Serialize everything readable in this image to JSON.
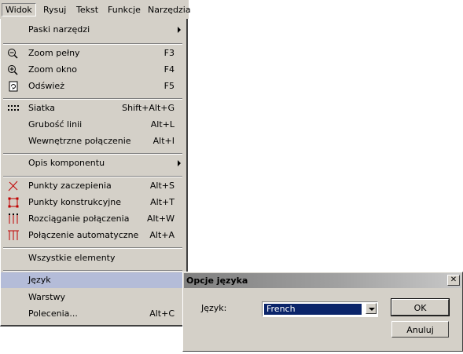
{
  "menubar": {
    "items": [
      {
        "label": "Widok"
      },
      {
        "label": "Rysuj"
      },
      {
        "label": "Tekst"
      },
      {
        "label": "Funkcje"
      },
      {
        "label": "Narzędzia"
      }
    ]
  },
  "menu": {
    "items": [
      {
        "label": "Paski narzędzi",
        "shortcut": "",
        "submenu": true
      },
      {
        "label": "Zoom pełny",
        "shortcut": "F3",
        "icon": "zoom-out-icon"
      },
      {
        "label": "Zoom okno",
        "shortcut": "F4",
        "icon": "zoom-in-icon"
      },
      {
        "label": "Odśwież",
        "shortcut": "F5",
        "icon": "refresh-icon"
      },
      {
        "label": "Siatka",
        "shortcut": "Shift+Alt+G",
        "icon": "grid-dots-icon"
      },
      {
        "label": "Grubość linii",
        "shortcut": "Alt+L"
      },
      {
        "label": "Wewnętrzne połączenie",
        "shortcut": "Alt+I"
      },
      {
        "label": "Opis komponentu",
        "shortcut": "",
        "submenu": true
      },
      {
        "label": "Punkty zaczepienia",
        "shortcut": "Alt+S",
        "icon": "cross-points-icon"
      },
      {
        "label": "Punkty konstrukcyjne",
        "shortcut": "Alt+T",
        "icon": "construction-points-icon"
      },
      {
        "label": "Rozciąganie połączenia",
        "shortcut": "Alt+W",
        "icon": "stretch-connection-icon"
      },
      {
        "label": "Połączenie automatyczne",
        "shortcut": "Alt+A",
        "icon": "auto-connection-icon"
      },
      {
        "label": "Wszystkie elementy",
        "shortcut": ""
      },
      {
        "label": "Język",
        "shortcut": "",
        "highlighted": true
      },
      {
        "label": "Warstwy",
        "shortcut": ""
      },
      {
        "label": "Polecenia...",
        "shortcut": "Alt+C"
      }
    ]
  },
  "dialog": {
    "title": "Opcje języka",
    "close_label": "✕",
    "language_label": "Język:",
    "language_value": "French",
    "ok_label": "OK",
    "cancel_label": "Anuluj"
  },
  "colors": {
    "menu_bg": "#d4d0c8",
    "highlight": "#b4bcd8",
    "selection": "#0a246a",
    "icon_red": "#c00000"
  }
}
